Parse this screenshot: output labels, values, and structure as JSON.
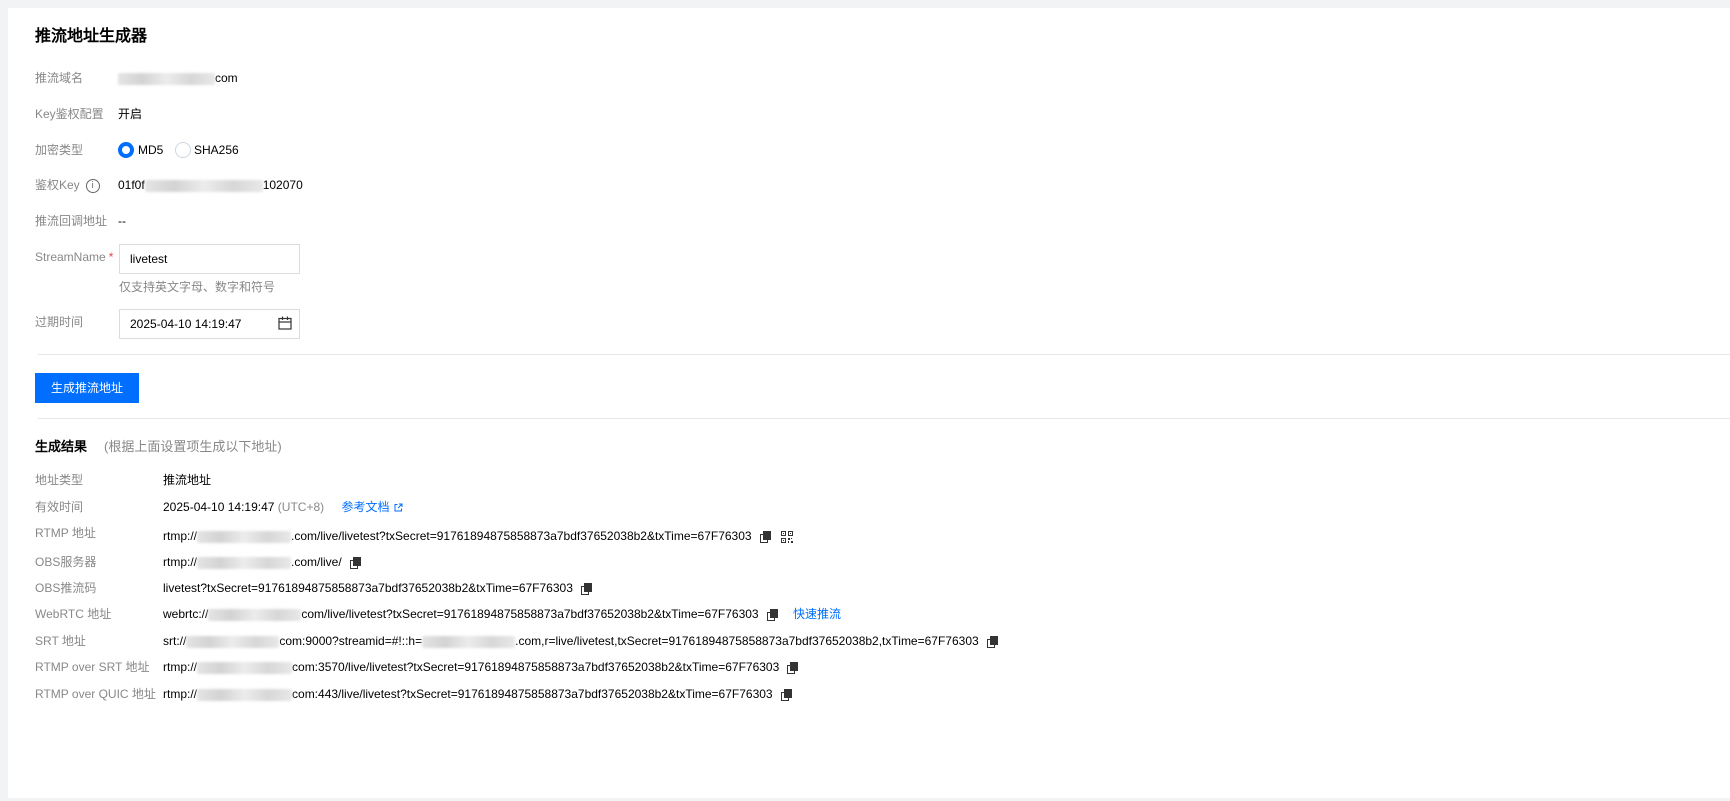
{
  "page": {
    "title": "推流地址生成器"
  },
  "form": {
    "domain_label": "推流域名",
    "domain_suffix": "com",
    "key_auth_label": "Key鉴权配置",
    "key_auth_value": "开启",
    "encrypt_label": "加密类型",
    "encrypt_options": [
      "MD5",
      "SHA256"
    ],
    "encrypt_selected": "MD5",
    "auth_key_label": "鉴权Key",
    "auth_key_prefix": "01f0f",
    "auth_key_suffix": "102070",
    "callback_label": "推流回调地址",
    "callback_value": "--",
    "stream_label": "StreamName",
    "stream_required": "*",
    "stream_value": "livetest",
    "stream_hint": "仅支持英文字母、数字和符号",
    "expire_label": "过期时间",
    "expire_value": "2025-04-10 14:19:47"
  },
  "actions": {
    "generate_label": "生成推流地址"
  },
  "result": {
    "title": "生成结果",
    "subtitle": "(根据上面设置项生成以下地址)",
    "type_label": "地址类型",
    "type_value": "推流地址",
    "valid_label": "有效时间",
    "valid_value": "2025-04-10 14:19:47",
    "valid_tz": "(UTC+8)",
    "doc_link": "参考文档",
    "rtmp_label": "RTMP 地址",
    "rtmp_prefix": "rtmp://",
    "rtmp_suffix": ".com/live/livetest?txSecret=91761894875858873a7bdf37652038b2&txTime=67F76303",
    "obs_server_label": "OBS服务器",
    "obs_server_prefix": "rtmp://",
    "obs_server_suffix": ".com/live/",
    "obs_code_label": "OBS推流码",
    "obs_code_value": "livetest?txSecret=91761894875858873a7bdf37652038b2&txTime=67F76303",
    "webrtc_label": "WebRTC 地址",
    "webrtc_prefix": "webrtc://",
    "webrtc_suffix": "com/live/livetest?txSecret=91761894875858873a7bdf37652038b2&txTime=67F76303",
    "webrtc_link": "快速推流",
    "srt_label": "SRT 地址",
    "srt_prefix": "srt://",
    "srt_mid": "com:9000?streamid=#!::h=",
    "srt_suffix": ".com,r=live/livetest,txSecret=91761894875858873a7bdf37652038b2,txTime=67F76303",
    "rtmp_srt_label": "RTMP over SRT 地址",
    "rtmp_srt_prefix": "rtmp://",
    "rtmp_srt_suffix": "com:3570/live/livetest?txSecret=91761894875858873a7bdf37652038b2&txTime=67F76303",
    "rtmp_quic_label": "RTMP over QUIC 地址",
    "rtmp_quic_prefix": "rtmp://",
    "rtmp_quic_suffix": "com:443/live/livetest?txSecret=91761894875858873a7bdf37652038b2&txTime=67F76303"
  },
  "icons": {
    "info": "info-icon",
    "calendar": "calendar-icon",
    "copy": "copy-icon",
    "qrcode": "qrcode-icon",
    "external": "external-link-icon"
  },
  "colors": {
    "primary": "#006eff",
    "required": "#e54545",
    "label": "#888888"
  }
}
